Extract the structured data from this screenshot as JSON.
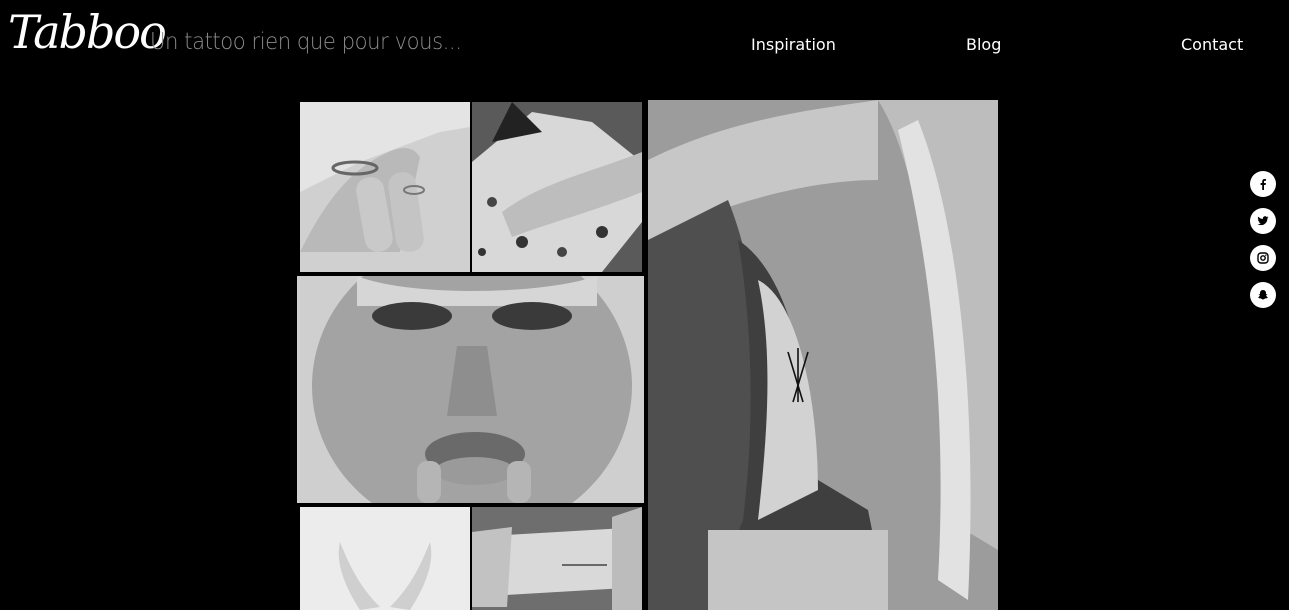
{
  "brand": {
    "logo_text": "Tabboo",
    "tagline": "Un tattoo rien que pour vous..."
  },
  "nav": {
    "items": [
      {
        "label": "Inspiration"
      },
      {
        "label": "Blog"
      },
      {
        "label": "Contact"
      }
    ]
  },
  "social": [
    "facebook-icon",
    "twitter-icon",
    "instagram-icon",
    "snapchat-icon"
  ],
  "gallery": [
    "photo-hand-ring-tattoo",
    "photo-arm-floral-tattoo",
    "photo-face-lip-tattoo",
    "photo-side-arrow-tattoo",
    "photo-hands-tattoo",
    "photo-wrist-script-tattoo"
  ]
}
